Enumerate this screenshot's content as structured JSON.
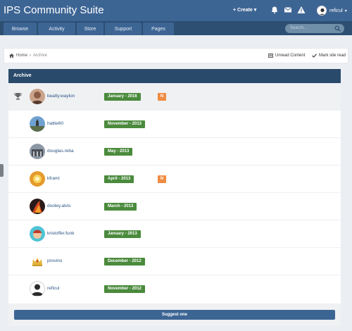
{
  "header": {
    "brand": "IPS Community Suite",
    "create_label": "+ Create ▾",
    "username": "reficul",
    "icons": [
      "bell-icon",
      "envelope-icon",
      "warning-icon"
    ]
  },
  "nav": {
    "tabs": [
      "Browse",
      "Activity",
      "Store",
      "Support",
      "Pages"
    ],
    "search_placeholder": "Search..."
  },
  "breadcrumb": {
    "home": "Home",
    "separator": "›",
    "current": "Archive",
    "unread_label": "Unread Content",
    "markread_label": "Mark site read"
  },
  "archive": {
    "title": "Archive",
    "entries": [
      {
        "user": "beatty.waylon",
        "date": "January - 2016",
        "badge": "N",
        "winner": true
      },
      {
        "user": "hattie60",
        "date": "November - 2013",
        "badge": "",
        "winner": false
      },
      {
        "user": "douglas.reba",
        "date": "May - 2013",
        "badge": "",
        "winner": false
      },
      {
        "user": "kframi",
        "date": "April - 2013",
        "badge": "N",
        "winner": false
      },
      {
        "user": "dooley.alvis",
        "date": "March - 2013",
        "badge": "",
        "winner": false
      },
      {
        "user": "kristoffer.funk",
        "date": "January - 2013",
        "badge": "",
        "winner": false
      },
      {
        "user": "provino",
        "date": "December - 2012",
        "badge": "",
        "winner": false
      },
      {
        "user": "reficul",
        "date": "November - 2012",
        "badge": "",
        "winner": false
      }
    ],
    "suggest_label": "Suggest one"
  },
  "colors": {
    "header": "#3d6594",
    "navbar": "#2c4f72",
    "panel_head": "#2a4a6b",
    "date_badge": "#4a8a3c",
    "new_badge": "#f08c41"
  }
}
